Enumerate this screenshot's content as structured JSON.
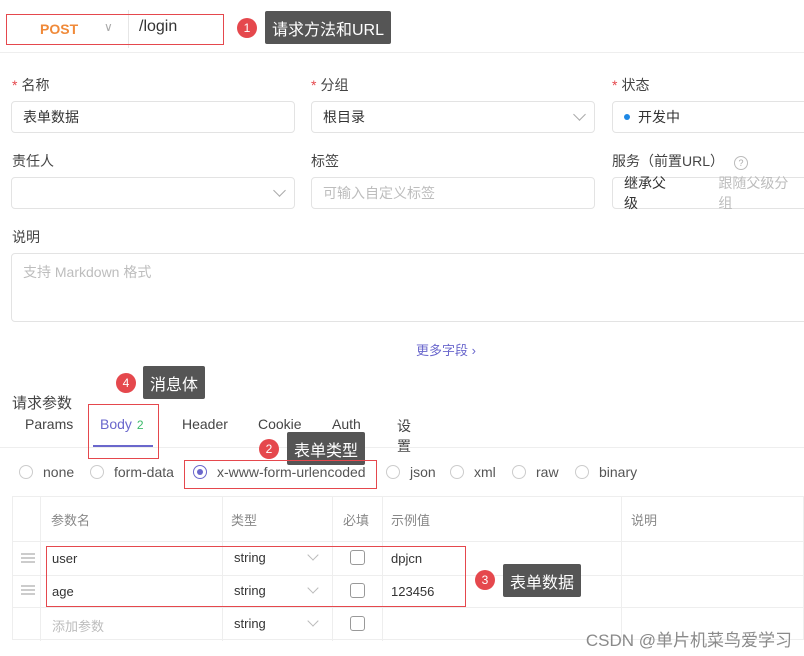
{
  "request": {
    "method": "POST",
    "url": "/login"
  },
  "callouts": [
    {
      "num": "1",
      "text": "请求方法和URL"
    },
    {
      "num": "2",
      "text": "表单类型"
    },
    {
      "num": "3",
      "text": "表单数据"
    },
    {
      "num": "4",
      "text": "消息体"
    }
  ],
  "form": {
    "name_label": "名称",
    "name_value": "表单数据",
    "group_label": "分组",
    "group_value": "根目录",
    "status_label": "状态",
    "status_value": "开发中",
    "owner_label": "责任人",
    "tags_label": "标签",
    "tags_placeholder": "可输入自定义标签",
    "service_label": "服务（前置URL）",
    "service_value": "继承父级",
    "service_hint": "跟随父级分组",
    "desc_label": "说明",
    "desc_placeholder": "支持 Markdown 格式",
    "more_fields": "更多字段 ›"
  },
  "params": {
    "title": "请求参数",
    "tabs": [
      {
        "label": "Params"
      },
      {
        "label": "Body",
        "badge": "2"
      },
      {
        "label": "Header"
      },
      {
        "label": "Cookie"
      },
      {
        "label": "Auth"
      },
      {
        "label": "设置"
      }
    ],
    "body_types": [
      "none",
      "form-data",
      "x-www-form-urlencoded",
      "json",
      "xml",
      "raw",
      "binary"
    ],
    "selected_body_type": "x-www-form-urlencoded",
    "columns": [
      "参数名",
      "类型",
      "必填",
      "示例值",
      "说明"
    ],
    "rows": [
      {
        "name": "user",
        "type": "string",
        "example": "dpjcn"
      },
      {
        "name": "age",
        "type": "string",
        "example": "123456"
      }
    ],
    "add_row": {
      "placeholder": "添加参数",
      "type": "string"
    }
  },
  "watermark": "CSDN @单片机菜鸟爱学习",
  "colors": {
    "accent": "#6a67cc",
    "post": "#f08a39",
    "annotation_red": "#e5484d"
  }
}
